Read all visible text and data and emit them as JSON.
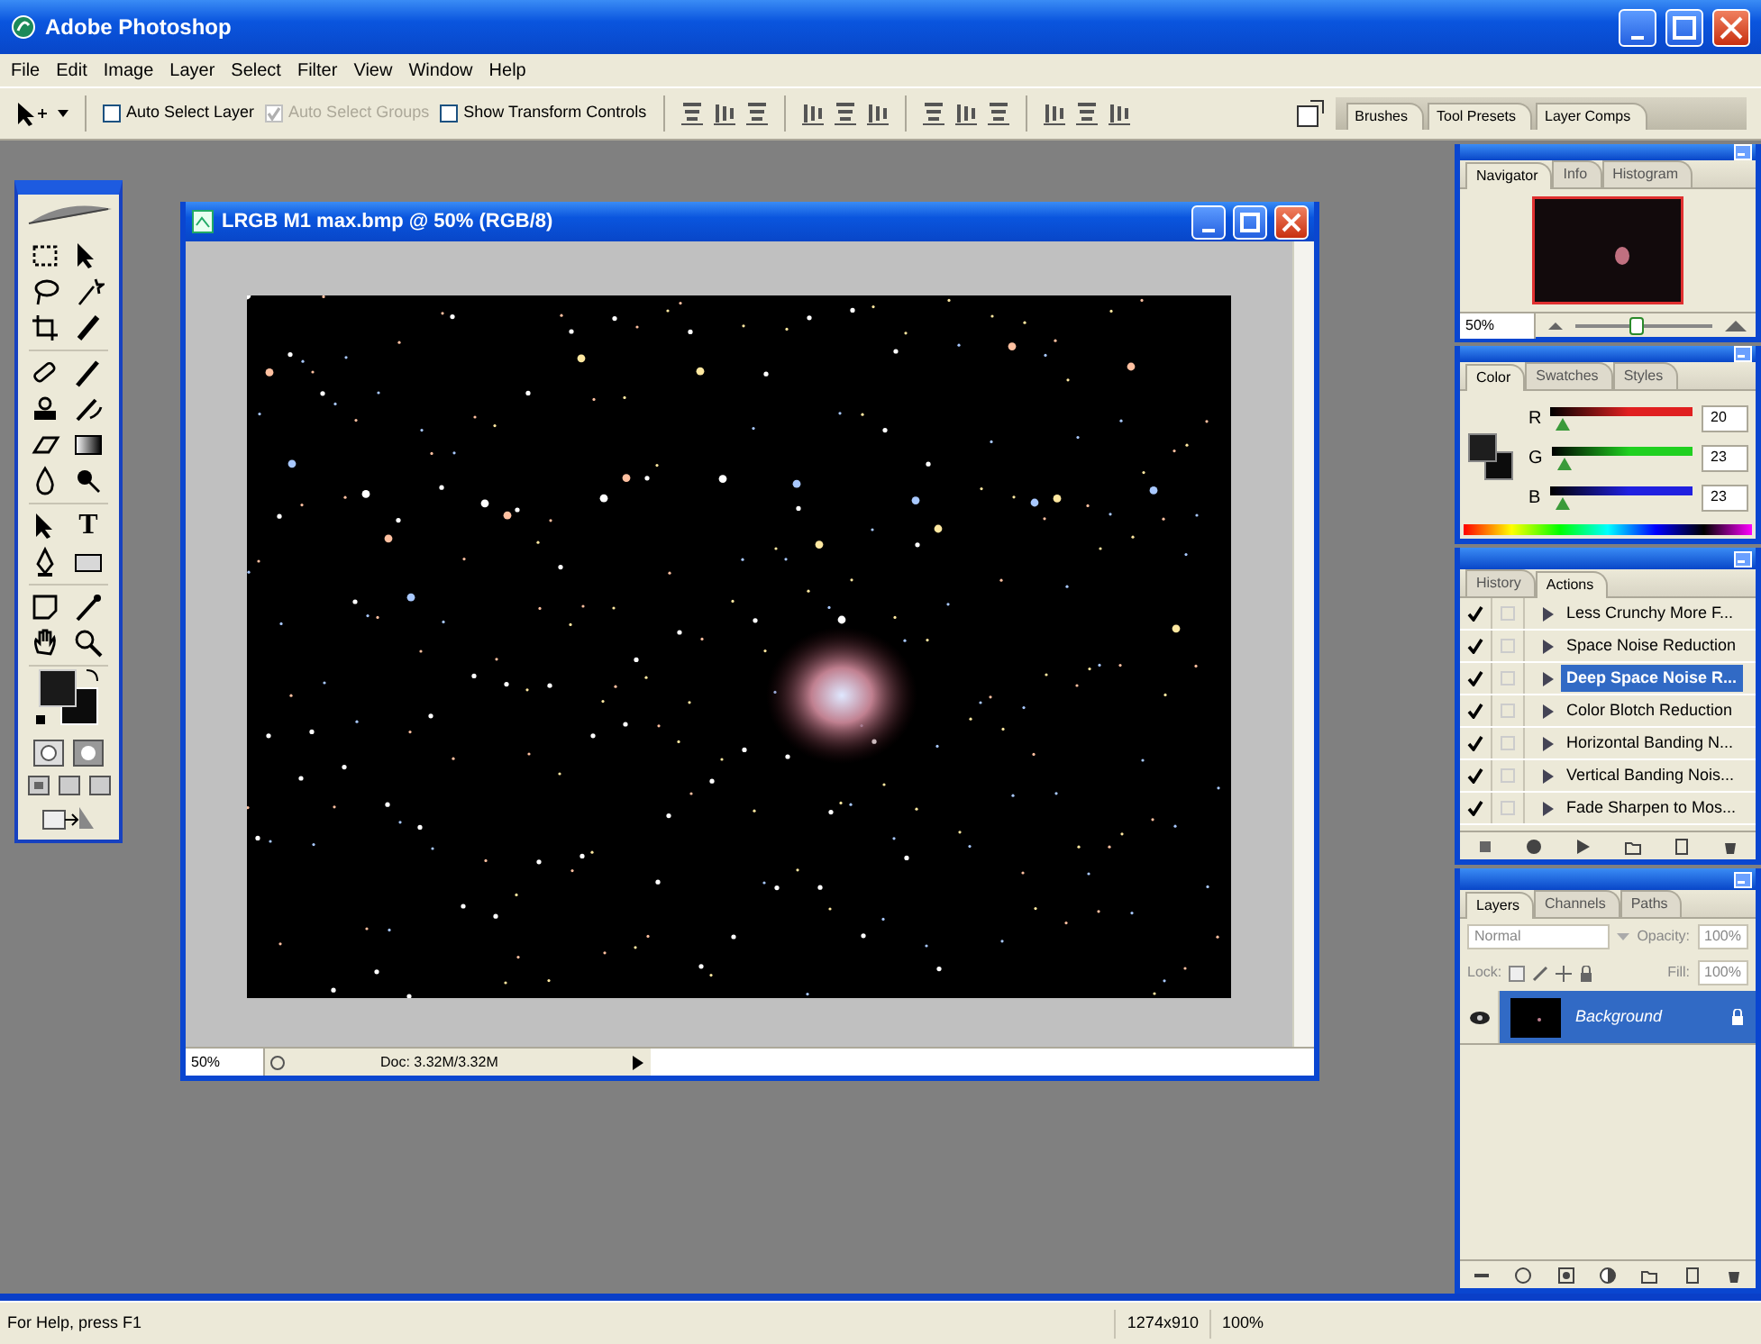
{
  "window": {
    "title": "Adobe Photoshop"
  },
  "menu": [
    "File",
    "Edit",
    "Image",
    "Layer",
    "Select",
    "Filter",
    "View",
    "Window",
    "Help"
  ],
  "options_bar": {
    "checkboxes": [
      {
        "label": "Auto Select Layer",
        "checked": false,
        "disabled": false
      },
      {
        "label": "Auto Select Groups",
        "checked": true,
        "disabled": true
      },
      {
        "label": "Show Transform Controls",
        "checked": false,
        "disabled": false
      }
    ],
    "palette_tabs": [
      "Brushes",
      "Tool Presets",
      "Layer Comps"
    ]
  },
  "toolbox": {
    "type_tool_glyph": "T"
  },
  "document": {
    "title": "LRGB M1 max.bmp @ 50% (RGB/8)",
    "zoom": "50%",
    "doc_info": "Doc: 3.32M/3.32M"
  },
  "navigator": {
    "tabs": [
      {
        "label": "Navigator",
        "selected": true
      },
      {
        "label": "Info",
        "selected": false
      },
      {
        "label": "Histogram",
        "selected": false
      }
    ],
    "zoom": "50%",
    "level": 0.45
  },
  "color": {
    "tabs": [
      {
        "label": "Color",
        "selected": true
      },
      {
        "label": "Swatches",
        "selected": false
      },
      {
        "label": "Styles",
        "selected": false
      }
    ],
    "channels": [
      {
        "name": "R",
        "value": "20",
        "level": 0.08,
        "color": "#e02020"
      },
      {
        "name": "G",
        "value": "23",
        "level": 0.09,
        "color": "#20d020"
      },
      {
        "name": "B",
        "value": "23",
        "level": 0.09,
        "color": "#2020e0"
      }
    ]
  },
  "actions": {
    "tabs": [
      {
        "label": "History",
        "selected": false
      },
      {
        "label": "Actions",
        "selected": true
      }
    ],
    "items": [
      {
        "label": "Less Crunchy More F...",
        "checked": true,
        "selected": false
      },
      {
        "label": "Space Noise Reduction",
        "checked": true,
        "selected": false
      },
      {
        "label": "Deep Space Noise R...",
        "checked": true,
        "selected": true
      },
      {
        "label": "Color Blotch Reduction",
        "checked": true,
        "selected": false
      },
      {
        "label": "Horizontal Banding N...",
        "checked": true,
        "selected": false
      },
      {
        "label": "Vertical Banding Nois...",
        "checked": true,
        "selected": false
      },
      {
        "label": "Fade Sharpen to Mos...",
        "checked": true,
        "selected": false
      }
    ]
  },
  "layers": {
    "tabs": [
      {
        "label": "Layers",
        "selected": true
      },
      {
        "label": "Channels",
        "selected": false
      },
      {
        "label": "Paths",
        "selected": false
      }
    ],
    "blend_mode": "Normal",
    "opacity_label": "Opacity:",
    "opacity": "100%",
    "lock_label": "Lock:",
    "fill_label": "Fill:",
    "fill": "100%",
    "items": [
      {
        "name": "Background",
        "visible": true,
        "selected": true
      }
    ]
  },
  "status_bar": {
    "help": "For Help, press F1",
    "size": "1274x910",
    "zoom": "100%"
  }
}
